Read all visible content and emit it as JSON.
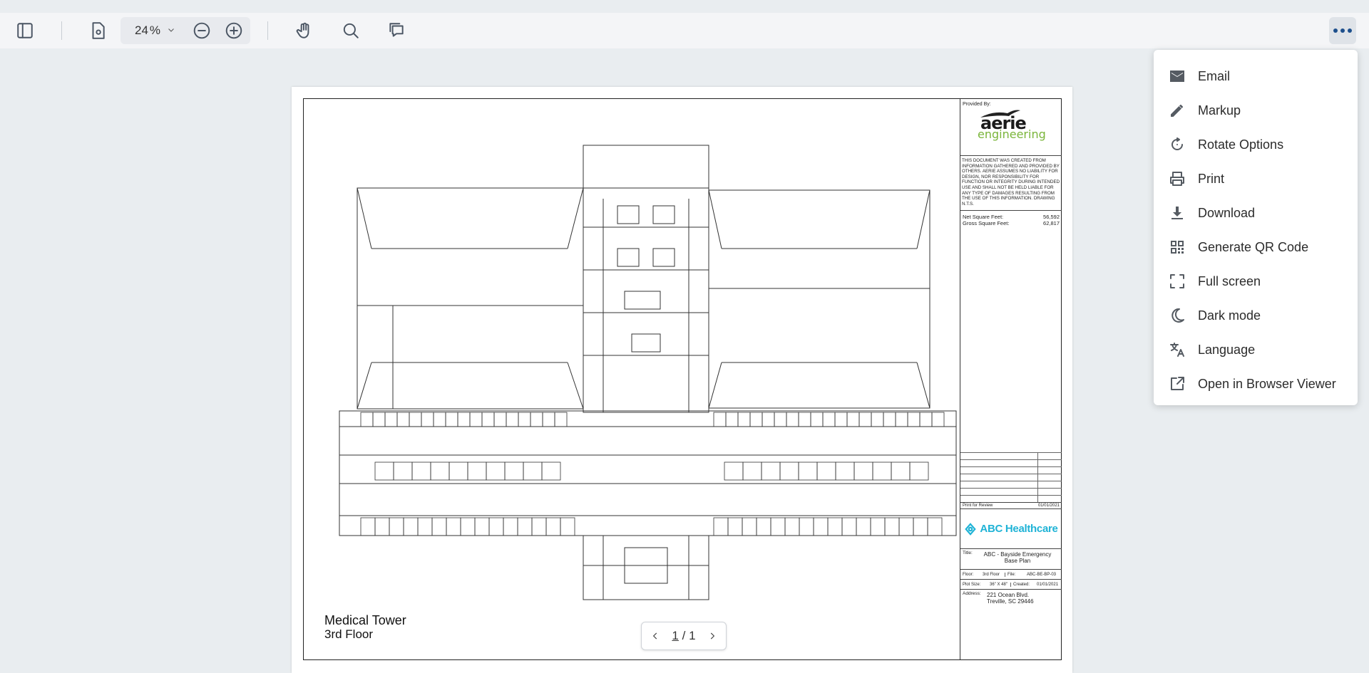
{
  "toolbar": {
    "zoom_value": "24",
    "zoom_unit": "%",
    "icons": [
      "sidebar-toggle-icon",
      "page-settings-icon",
      "chevron-down-icon",
      "zoom-out-icon",
      "zoom-in-icon",
      "pan-hand-icon",
      "search-icon",
      "comment-icon",
      "more-options-icon"
    ]
  },
  "document": {
    "provided_by": "Provided By:",
    "logo_word1": "aerie",
    "logo_word2": "engineering",
    "disclaimer": "THIS DOCUMENT WAS CREATED FROM INFORMATION GATHERED AND PROVIDED BY OTHERS. AERIE ASSUMES NO LIABILITY FOR DESIGN, NOR RESPONSIBILITY FOR FUNCTION OR INTEGRITY DURING INTENDED USE AND SHALL NOT BE HELD LIABLE FOR ANY TYPE OF DAMAGES RESULTING FROM THE USE OF THIS INFORMATION. DRAWING N.T.S.",
    "net_sqft_label": "Net Square Feet:",
    "net_sqft_value": "56,592",
    "gross_sqft_label": "Gross Square Feet:",
    "gross_sqft_value": "62,817",
    "review_label": "Print for Review",
    "review_date": "01/01/2021",
    "client": "ABC Healthcare",
    "title_label": "Title:",
    "title_value_line1": "ABC - Bayside Emergency",
    "title_value_line2": "Base Plan",
    "floor_label": "Floor:",
    "floor_value": "3rd Floor",
    "file_label": "File:",
    "file_value": "ABC-BE-BP-03",
    "plot_label": "Plot Size:",
    "plot_value": "36\" X 48\"",
    "created_label": "Created:",
    "created_value": "01/01/2021",
    "address_label": "Address:",
    "address_line1": "221 Ocean Blvd.",
    "address_line2": "Treville, SC 29446",
    "caption_line1": "Medical Tower",
    "caption_line2": "3rd Floor"
  },
  "pager": {
    "current": "1",
    "separator": "/",
    "total": "1"
  },
  "menu": {
    "items": [
      {
        "label": "Email",
        "icon": "email-icon"
      },
      {
        "label": "Markup",
        "icon": "pencil-icon"
      },
      {
        "label": "Rotate Options",
        "icon": "rotate-icon"
      },
      {
        "label": "Print",
        "icon": "printer-icon"
      },
      {
        "label": "Download",
        "icon": "download-icon"
      },
      {
        "label": "Generate QR Code",
        "icon": "qr-code-icon"
      },
      {
        "label": "Full screen",
        "icon": "fullscreen-icon"
      },
      {
        "label": "Dark mode",
        "icon": "moon-icon"
      },
      {
        "label": "Language",
        "icon": "translate-icon"
      },
      {
        "label": "Open in Browser Viewer",
        "icon": "external-link-icon"
      }
    ]
  },
  "colors": {
    "accent": "#1d4f8c",
    "client_brand": "#1fb3d6",
    "logo_green": "#7ab53a",
    "background": "#e9edf0"
  }
}
